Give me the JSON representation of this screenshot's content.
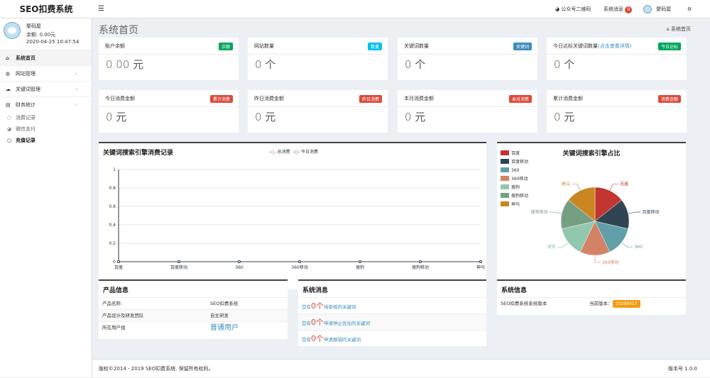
{
  "app": {
    "title": "SEO扣费系统"
  },
  "topbar": {
    "wechat_label": "公众号二维码",
    "messages_label": "系统消息",
    "messages_count": "0",
    "username": "聚码屋"
  },
  "user": {
    "name": "聚码屋",
    "balance": "余额: 0.00元",
    "time": "2020-04-25 10:47:54"
  },
  "menu": [
    {
      "label": "系统首页",
      "active": true,
      "icon": "home-icon"
    },
    {
      "label": "网站管理",
      "icon": "globe-icon",
      "arrow": "‹"
    },
    {
      "label": "关键词管理",
      "icon": "cloud-icon",
      "arrow": "‹"
    },
    {
      "label": "财务统计",
      "icon": "finance-icon",
      "arrow": "‹"
    }
  ],
  "submenu": [
    {
      "label": "消费记录"
    },
    {
      "label": "微信支付"
    },
    {
      "label": "充值记录",
      "active": true
    }
  ],
  "page": {
    "title": "系统首页",
    "breadcrumb": "系统首页"
  },
  "cards": [
    {
      "title": "账户余额",
      "badge": "余额",
      "badge_color": "#00a65a",
      "value": "0.00 元"
    },
    {
      "title": "网站数量",
      "badge": "数量",
      "badge_color": "#00c0ef",
      "value": "0 个"
    },
    {
      "title": "关键词数量",
      "badge": "关键词",
      "badge_color": "#3c8dbc",
      "value": "0 个"
    },
    {
      "title": "今日达标关键词数量",
      "hint": "(点击查看详情)",
      "badge": "今日达标",
      "badge_color": "#00a65a",
      "value": "0 个"
    },
    {
      "title": "今日消费金额",
      "badge": "累计消费",
      "badge_color": "#dd4b39",
      "value": "0 元"
    },
    {
      "title": "昨日消费金额",
      "badge": "昨日消费",
      "badge_color": "#dd4b39",
      "value": "0 元"
    },
    {
      "title": "本月消费金额",
      "badge": "本月消费",
      "badge_color": "#dd4b39",
      "value": "0 元"
    },
    {
      "title": "累计消费金额",
      "badge": "消费金额",
      "badge_color": "#dd4b39",
      "value": "0 元"
    }
  ],
  "line_chart": {
    "title": "关键词搜索引擎消费记录",
    "legend": [
      "总消费",
      "今日消费"
    ]
  },
  "pie_chart": {
    "title": "关键词搜索引擎占比"
  },
  "chart_data": [
    {
      "type": "line",
      "categories": [
        "百度",
        "百度移动",
        "360",
        "360移动",
        "搜狗",
        "搜狗移动",
        "神马"
      ],
      "series": [
        {
          "name": "总消费",
          "values": [
            0,
            0,
            0,
            0,
            0,
            0,
            0
          ],
          "color": "#c23531"
        },
        {
          "name": "今日消费",
          "values": [
            0,
            0,
            0,
            0,
            0,
            0,
            0
          ],
          "color": "#2f4554"
        }
      ],
      "yticks": [
        "0",
        "0.2",
        "0.4",
        "0.6",
        "0.8",
        "1"
      ],
      "ylim": [
        0,
        1
      ]
    },
    {
      "type": "pie",
      "slices": [
        {
          "name": "百度",
          "value": 1,
          "color": "#c23531"
        },
        {
          "name": "百度移动",
          "value": 1,
          "color": "#2f4554"
        },
        {
          "name": "360",
          "value": 1,
          "color": "#61a0a8"
        },
        {
          "name": "360移动",
          "value": 1,
          "color": "#d48265"
        },
        {
          "name": "搜狗",
          "value": 1,
          "color": "#91c7ae"
        },
        {
          "name": "搜狗移动",
          "value": 1,
          "color": "#749f83"
        },
        {
          "name": "神马",
          "value": 1,
          "color": "#ca8622"
        }
      ],
      "legend_position": "top-left"
    }
  ],
  "product": {
    "title": "产品信息",
    "rows": [
      {
        "k": "产品名称",
        "v": "SEO扣费系统"
      },
      {
        "k": "产品设计及研发团队",
        "v": "自主研发"
      },
      {
        "k": "所在用户组",
        "v": "普通用户"
      }
    ]
  },
  "messages": {
    "title": "系统消息",
    "rows": [
      {
        "pre": "您有",
        "num": "0个",
        "text": "待审核的关键词"
      },
      {
        "pre": "您有",
        "num": "0个",
        "text": "申请停止优化的关键词"
      },
      {
        "pre": "您有",
        "num": "0个",
        "text": "申请报错的关键词"
      }
    ]
  },
  "sysinfo": {
    "title": "系统信息",
    "label": "SEO扣费系统系统版本",
    "cur_label": "当前版本：",
    "version": "20200417"
  },
  "footer": {
    "copyright": "版权©2014 - 2019 SEO扣费系统. 保留所有权利。",
    "version": "版本号 1.0.0"
  }
}
